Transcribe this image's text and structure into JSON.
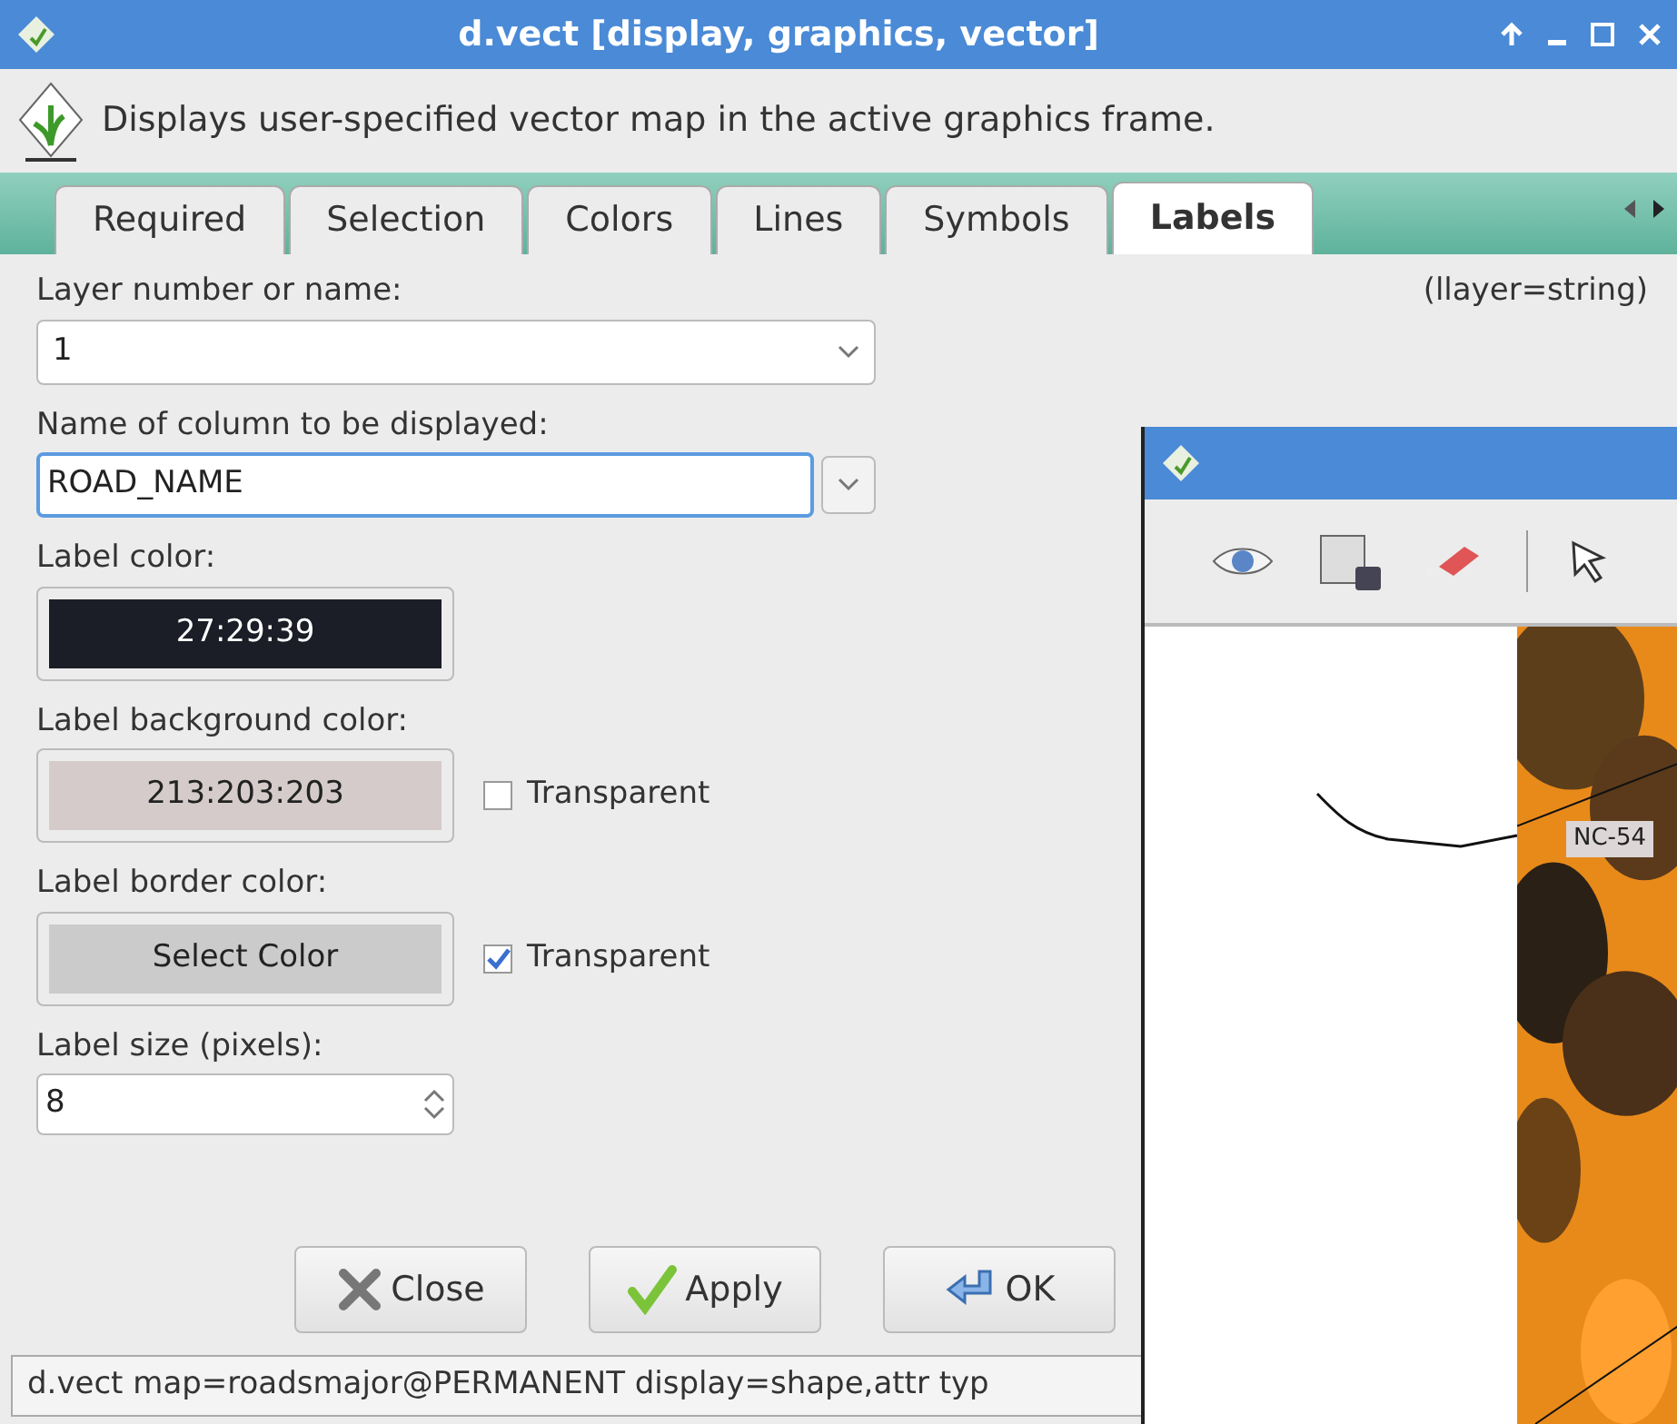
{
  "window": {
    "title": "d.vect [display, graphics, vector]"
  },
  "description": "Displays user-specified vector map in the active graphics frame.",
  "tabs": [
    {
      "label": "Required",
      "selected": false
    },
    {
      "label": "Selection",
      "selected": false
    },
    {
      "label": "Colors",
      "selected": false
    },
    {
      "label": "Lines",
      "selected": false
    },
    {
      "label": "Symbols",
      "selected": false
    },
    {
      "label": "Labels",
      "selected": true
    }
  ],
  "fields": [
    {
      "kind": "combo",
      "label": "Layer number or name:",
      "value": "1",
      "hint": "(llayer=string)"
    },
    {
      "kind": "text_combo",
      "label": "Name of column to be displayed:",
      "value": "ROAD_NAME"
    },
    {
      "kind": "color",
      "label": "Label color:",
      "value": "27:29:39",
      "color": "#1b1d27"
    },
    {
      "kind": "color",
      "label": "Label background color:",
      "value": "213:203:203",
      "color": "#d5cbcb",
      "transparent": {
        "label": "Transparent",
        "checked": false
      }
    },
    {
      "kind": "color",
      "label": "Label border color:",
      "value": "Select Color",
      "color": "#cbcbcb",
      "transparent": {
        "label": "Transparent",
        "checked": true
      }
    },
    {
      "kind": "spin",
      "label": "Label size (pixels):",
      "value": "8"
    }
  ],
  "buttons": [
    {
      "kind": "close",
      "label": "Close"
    },
    {
      "kind": "apply",
      "label": "Apply"
    },
    {
      "kind": "ok",
      "label": "OK"
    }
  ],
  "status_bar": "d.vect map=roadsmajor@PERMANENT display=shape,attr typ",
  "map_window": {
    "road_label": "NC-54"
  }
}
